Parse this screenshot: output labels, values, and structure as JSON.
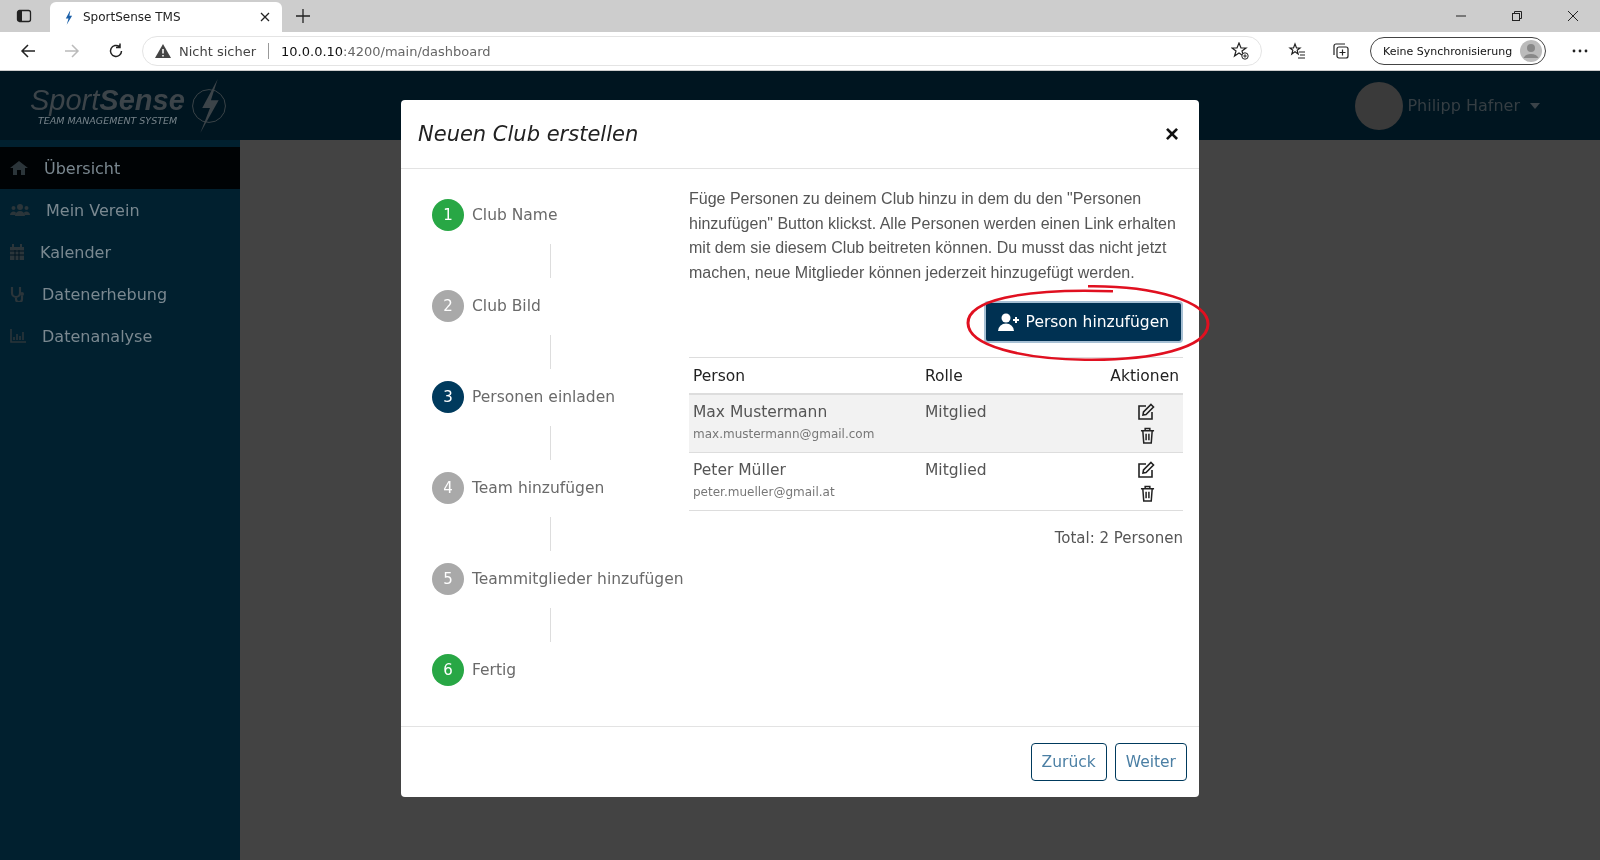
{
  "browser": {
    "tab": {
      "title": "SportSense TMS"
    },
    "address": {
      "security": "Nicht sicher",
      "url_host": "10.0.0.10",
      "url_rest": ":4200/main/dashboard"
    },
    "sync_button": "Keine Synchronisierung"
  },
  "app": {
    "logo": {
      "name_light": "Sport",
      "name_bold": "Sense",
      "tagline": "TEAM MANAGEMENT SYSTEM"
    },
    "user": {
      "name": "Philipp Hafner"
    }
  },
  "sidebar": {
    "items": [
      {
        "label": "Übersicht",
        "selected": true
      },
      {
        "label": "Mein Verein",
        "selected": false
      },
      {
        "label": "Kalender",
        "selected": false
      },
      {
        "label": "Datenerhebung",
        "selected": false
      },
      {
        "label": "Datenanalyse",
        "selected": false
      }
    ]
  },
  "modal": {
    "title": "Neuen Club erstellen",
    "close": "×",
    "steps": [
      {
        "number": "1",
        "label": "Club Name",
        "color": "#28a745"
      },
      {
        "number": "2",
        "label": "Club Bild",
        "color": "#a9a9a9"
      },
      {
        "number": "3",
        "label": "Personen einladen",
        "color": "#003a5d"
      },
      {
        "number": "4",
        "label": "Team hinzufügen",
        "color": "#a9a9a9"
      },
      {
        "number": "5",
        "label": "Teammitglieder hinzufügen",
        "color": "#a9a9a9"
      },
      {
        "number": "6",
        "label": "Fertig",
        "color": "#28a745"
      }
    ],
    "description": "Füge Personen zu deinem Club hinzu in dem du den \"Personen hinzufügen\" Button klickst. Alle Personen werden einen Link erhalten mit dem sie diesem Club beitreten können. Du musst das nicht jetzt machen, neue Mitglieder können jederzeit hinzugefügt werden.",
    "add_button": "Person hinzufügen",
    "add_button_highlighted": true,
    "table": {
      "columns": [
        "Person",
        "Rolle",
        "Aktionen"
      ],
      "rows": [
        {
          "name": "Max Mustermann",
          "email": "max.mustermann@gmail.com",
          "role": "Mitglied"
        },
        {
          "name": "Peter Müller",
          "email": "peter.mueller@gmail.at",
          "role": "Mitglied"
        }
      ]
    },
    "total": "Total: 2 Personen",
    "buttons": [
      "Zurück",
      "Weiter"
    ]
  }
}
